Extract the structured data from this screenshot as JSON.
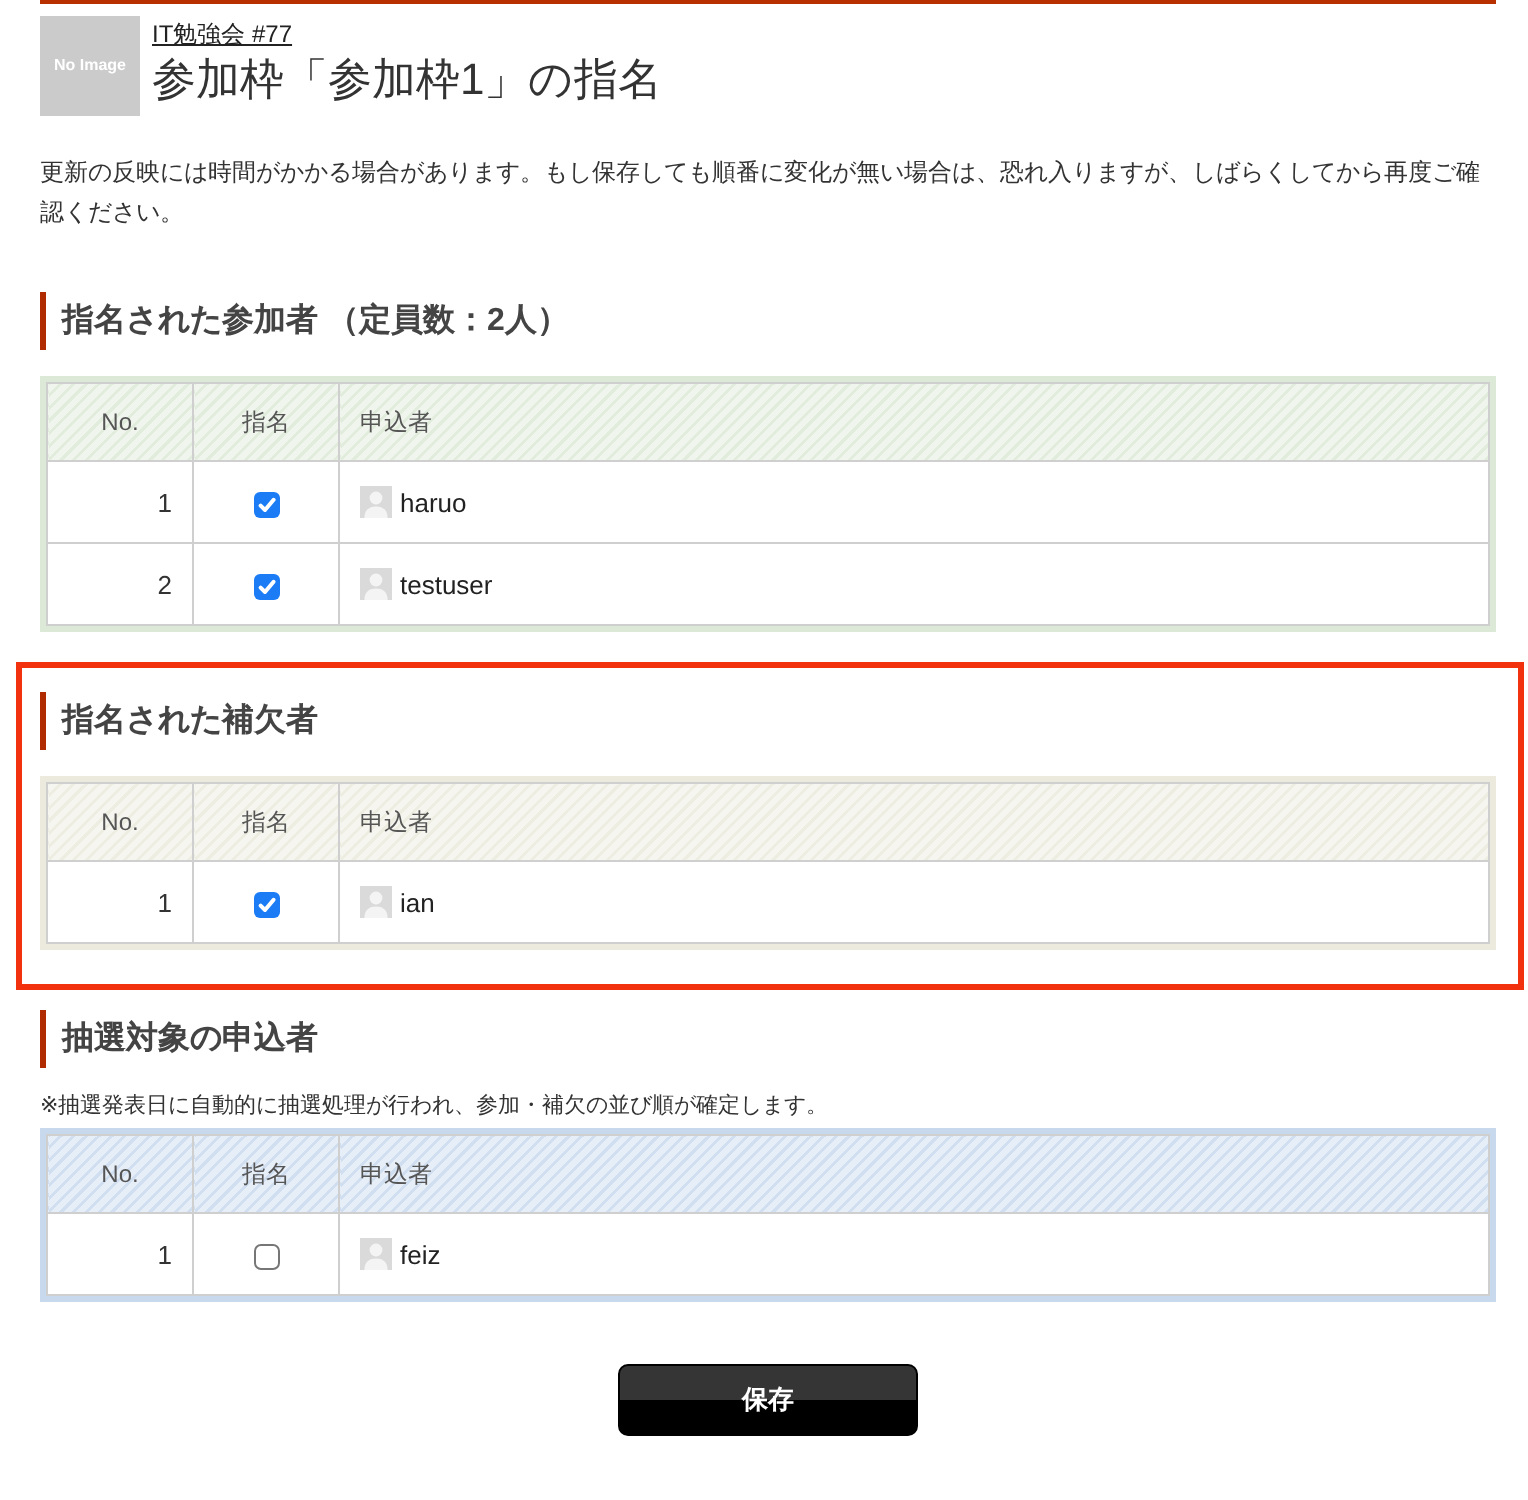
{
  "header": {
    "thumbnail": "No Image",
    "event_link": "IT勉強会 #77",
    "title": "参加枠「参加枠1」の指名"
  },
  "notice": "更新の反映には時間がかかる場合があります。もし保存しても順番に変化が無い場合は、恐れ入りますが、しばらくしてから再度ご確認ください。",
  "sections": [
    {
      "heading": "指名された参加者 （定員数：2人）",
      "highlighted": false,
      "color": "#dde9d7",
      "columns": [
        "No.",
        "指名",
        "申込者"
      ],
      "rows": [
        {
          "no": "1",
          "checked": true,
          "name": "haruo"
        },
        {
          "no": "2",
          "checked": true,
          "name": "testuser"
        }
      ]
    },
    {
      "heading": "指名された補欠者",
      "highlighted": true,
      "color": "#ebeadd",
      "columns": [
        "No.",
        "指名",
        "申込者"
      ],
      "rows": [
        {
          "no": "1",
          "checked": true,
          "name": "ian"
        }
      ]
    },
    {
      "heading": "抽選対象の申込者",
      "highlighted": false,
      "note": "※抽選発表日に自動的に抽選処理が行われ、参加・補欠の並び順が確定します。",
      "color": "#c8d9ee",
      "columns": [
        "No.",
        "指名",
        "申込者"
      ],
      "rows": [
        {
          "no": "1",
          "checked": false,
          "name": "feiz"
        }
      ]
    }
  ],
  "save_button": "保存"
}
